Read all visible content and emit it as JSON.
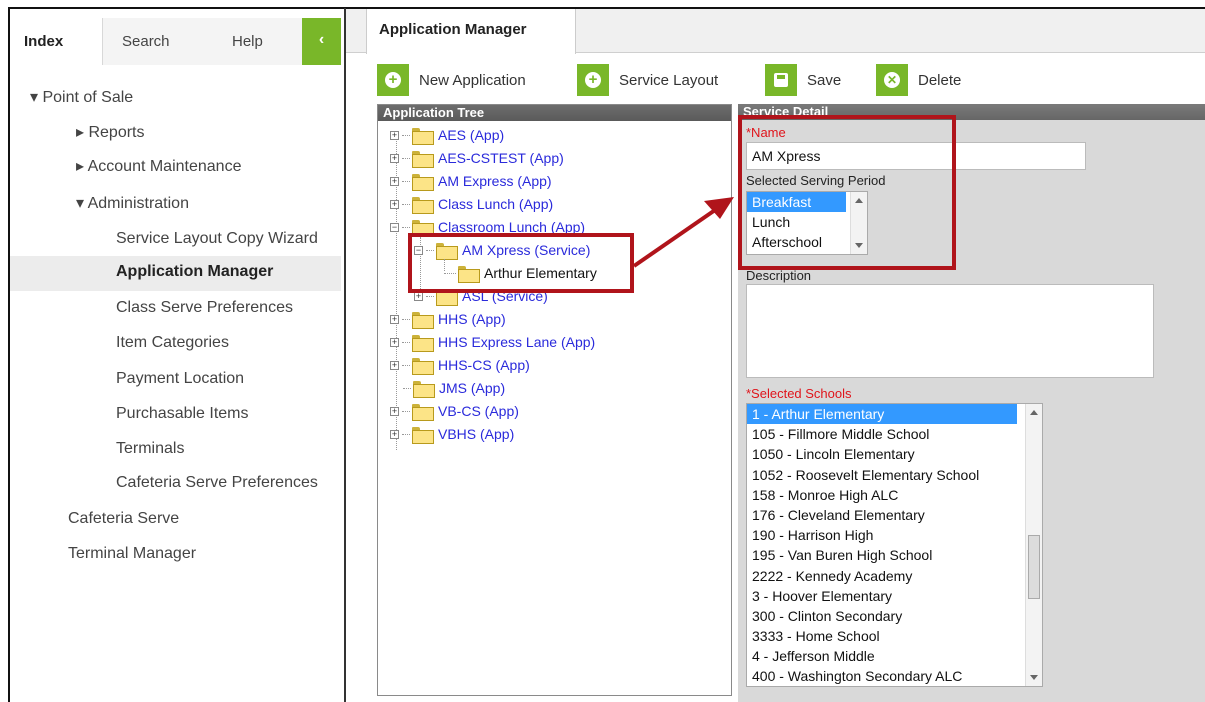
{
  "nav": {
    "tabs": [
      {
        "label": "Index"
      },
      {
        "label": "Search"
      },
      {
        "label": "Help"
      }
    ],
    "collapse_glyph": "‹",
    "items": [
      {
        "label": "▾ Point of Sale"
      },
      {
        "label": "▸ Reports"
      },
      {
        "label": "▸ Account Maintenance"
      },
      {
        "label": "▾ Administration"
      },
      {
        "label": "Service Layout Copy Wizard"
      },
      {
        "label": "Application Manager"
      },
      {
        "label": "Class Serve Preferences"
      },
      {
        "label": "Item Categories"
      },
      {
        "label": "Payment Location"
      },
      {
        "label": "Purchasable Items"
      },
      {
        "label": "Terminals"
      },
      {
        "label": "Cafeteria Serve Preferences"
      },
      {
        "label": "Cafeteria Serve"
      },
      {
        "label": "Terminal Manager"
      }
    ]
  },
  "header": {
    "tab_title": "Application Manager"
  },
  "toolbar": {
    "new_application": "New Application",
    "service_layout": "Service Layout",
    "save": "Save",
    "delete": "Delete"
  },
  "tree": {
    "title": "Application Tree",
    "nodes": [
      {
        "label": "AES (App)"
      },
      {
        "label": "AES-CSTEST (App)"
      },
      {
        "label": "AM Express (App)"
      },
      {
        "label": "Class Lunch (App)"
      },
      {
        "label": "Classroom Lunch (App)"
      },
      {
        "label": "AM Xpress (Service)"
      },
      {
        "label": "Arthur Elementary"
      },
      {
        "label": "ASL (Service)"
      },
      {
        "label": "HHS (App)"
      },
      {
        "label": "HHS Express Lane (App)"
      },
      {
        "label": "HHS-CS (App)"
      },
      {
        "label": "JMS (App)"
      },
      {
        "label": "VB-CS (App)"
      },
      {
        "label": "VBHS (App)"
      }
    ]
  },
  "detail": {
    "title": "Service Detail",
    "name_label": "*Name",
    "name_value": "AM Xpress",
    "period_label": "Selected Serving Period",
    "periods": [
      "Breakfast",
      "Lunch",
      "Afterschool"
    ],
    "selected_period": "Breakfast",
    "description_label": "Description",
    "description_value": "",
    "schools_label": "*Selected Schools",
    "schools": [
      "1 - Arthur Elementary",
      "105 - Fillmore Middle School",
      "1050 - Lincoln Elementary",
      "1052 - Roosevelt Elementary School",
      "158 - Monroe High ALC",
      "176 - Cleveland Elementary",
      "190 - Harrison High",
      "195 - Van Buren High School",
      "2222 - Kennedy Academy",
      "3 - Hoover Elementary",
      "300 - Clinton Secondary",
      "3333 - Home School",
      "4 - Jefferson Middle",
      "400 - Washington Secondary ALC"
    ],
    "selected_school": "1 - Arthur Elementary"
  },
  "colors": {
    "accent_green": "#79b729",
    "highlight_red": "#b0141b",
    "selection_blue": "#3399ff",
    "tree_link": "#2a2adb",
    "required_red": "#e0141b"
  }
}
